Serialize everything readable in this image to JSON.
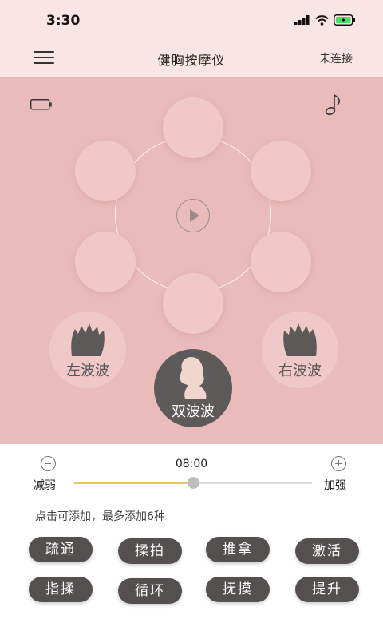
{
  "status_bar": {
    "time": "3:30"
  },
  "nav": {
    "title": "健胸按摩仪",
    "connection_status": "未连接"
  },
  "waves": {
    "left_label": "左波波",
    "right_label": "右波波",
    "dual_label": "双波波"
  },
  "slider": {
    "time": "08:00",
    "weaken_label": "减弱",
    "strengthen_label": "加强",
    "value_percent": 50
  },
  "hint": "点击可添加，最多添加6种",
  "modes": [
    "疏通",
    "揉拍",
    "推拿",
    "激活",
    "指揉",
    "循环",
    "抚摸",
    "提升"
  ],
  "colors": {
    "panel": "#e9bcbb",
    "slider_fill": "#e8c56a",
    "mode_button": "#555050"
  }
}
